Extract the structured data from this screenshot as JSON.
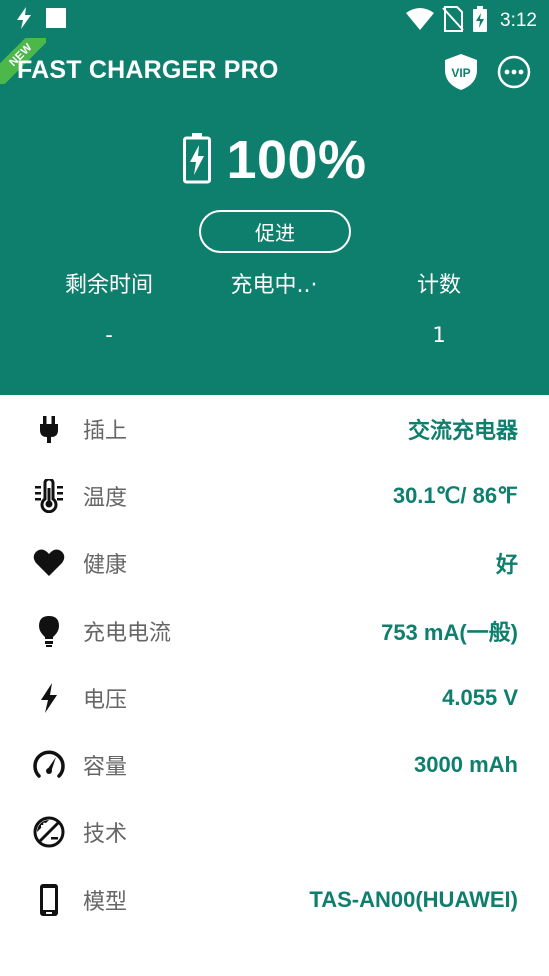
{
  "status_bar": {
    "time": "3:12",
    "icons": [
      "flash-icon",
      "square-notification-icon",
      "wifi-icon",
      "no-sim-icon",
      "battery-charging-icon"
    ]
  },
  "app": {
    "ribbon": "NEW",
    "title": "FAST CHARGER PRO",
    "vip_label": "VIP"
  },
  "battery": {
    "percent_text": "100%",
    "level": 1.0
  },
  "promote_button": "促进",
  "stats": [
    {
      "label": "剩余时间",
      "value": "-"
    },
    {
      "label": "充电中..·",
      "value": ""
    },
    {
      "label": "计数",
      "value": "1"
    }
  ],
  "info": [
    {
      "icon": "plug-icon",
      "label": "插上",
      "value": "交流充电器"
    },
    {
      "icon": "thermometer-icon",
      "label": "温度",
      "value": "30.1℃/ 86℉"
    },
    {
      "icon": "heart-icon",
      "label": "健康",
      "value": "好"
    },
    {
      "icon": "lightbulb-icon",
      "label": "充电电流",
      "value": "753 mA(一般)"
    },
    {
      "icon": "lightning-icon",
      "label": "电压",
      "value": "4.055 V"
    },
    {
      "icon": "speedometer-icon",
      "label": "容量",
      "value": "3000 mAh"
    },
    {
      "icon": "technology-icon",
      "label": "技术",
      "value": ""
    },
    {
      "icon": "phone-icon",
      "label": "模型",
      "value": "TAS-AN00(HUAWEI)"
    }
  ],
  "colors": {
    "primary": "#0e7f6d",
    "ribbon": "#4cb84a"
  }
}
